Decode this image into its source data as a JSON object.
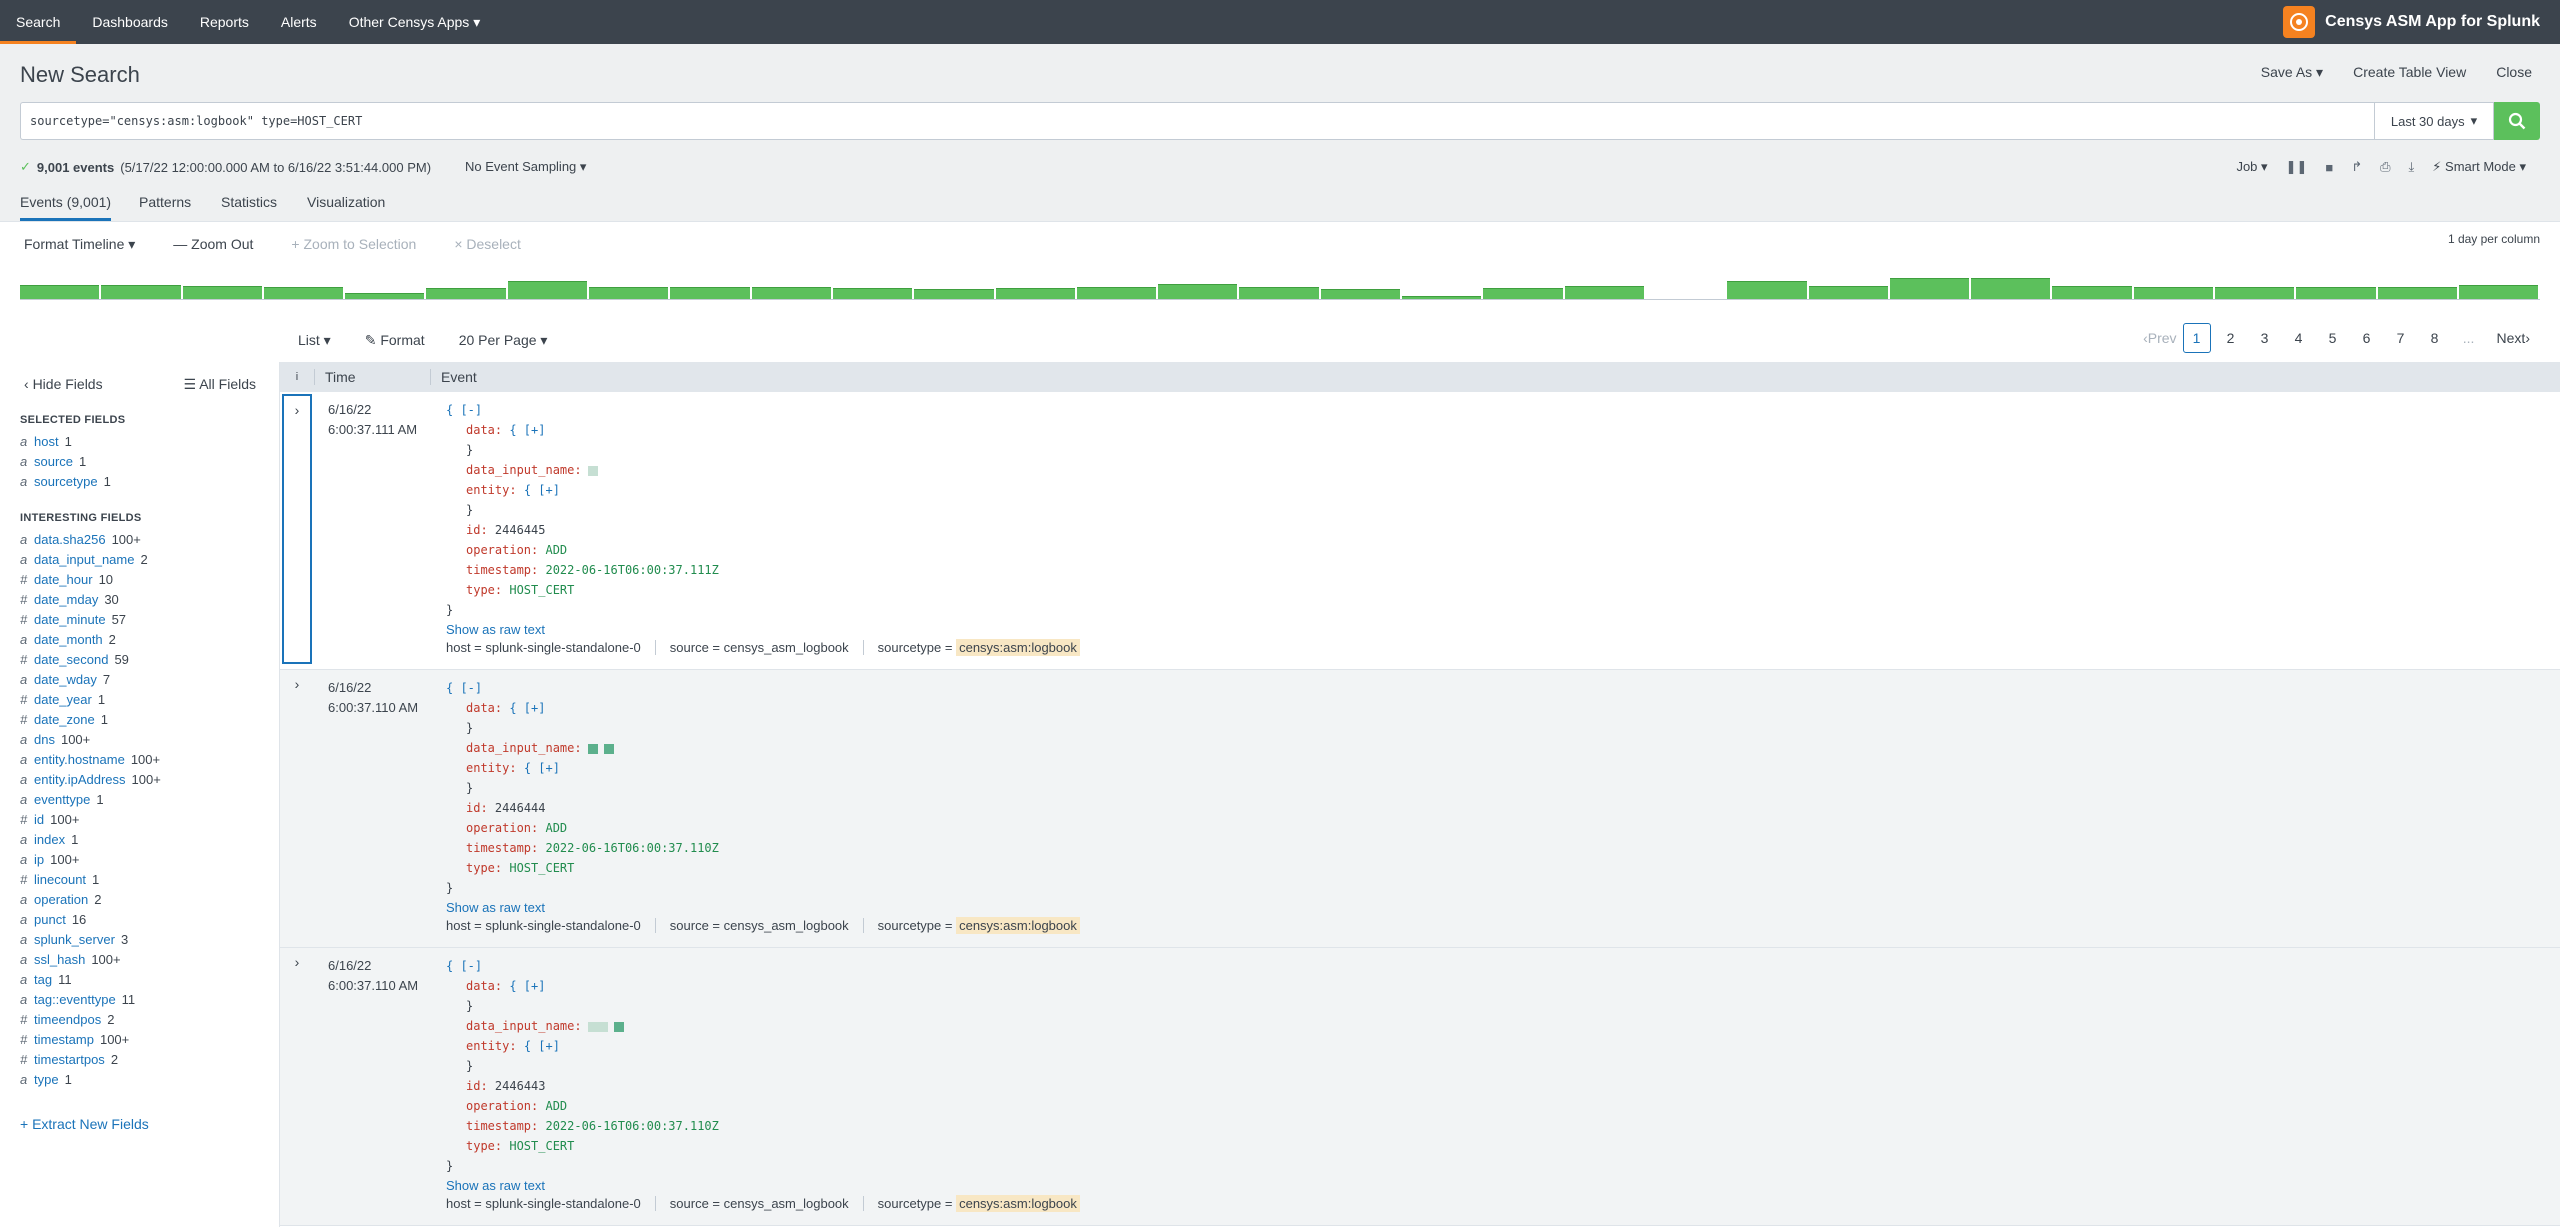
{
  "topbar": {
    "nav": [
      "Search",
      "Dashboards",
      "Reports",
      "Alerts",
      "Other Censys Apps"
    ],
    "active": "Search",
    "app_name": "Censys ASM App for Splunk"
  },
  "header": {
    "title": "New Search",
    "actions": [
      "Save As",
      "Create Table View",
      "Close"
    ]
  },
  "search": {
    "query": "sourcetype=\"censys:asm:logbook\" type=HOST_CERT",
    "time_range": "Last 30 days"
  },
  "status": {
    "count": "9,001 events",
    "range": "(5/17/22 12:00:00.000 AM to 6/16/22 3:51:44.000 PM)",
    "sampling": "No Event Sampling",
    "job": "Job",
    "mode": "Smart Mode"
  },
  "tabs": [
    "Events (9,001)",
    "Patterns",
    "Statistics",
    "Visualization"
  ],
  "timeline": {
    "controls": [
      "Format Timeline",
      "Zoom Out",
      "+ Zoom to Selection",
      "× Deselect"
    ],
    "scale": "1 day per column",
    "bars": [
      0.45,
      0.45,
      0.42,
      0.4,
      0.2,
      0.35,
      0.58,
      0.4,
      0.38,
      0.38,
      0.35,
      0.32,
      0.35,
      0.38,
      0.5,
      0.38,
      0.32,
      0.1,
      0.35,
      0.42,
      0,
      0.58,
      0.42,
      0.68,
      0.68,
      0.42,
      0.4,
      0.4,
      0.4,
      0.38,
      0.45
    ]
  },
  "results_toolbar": {
    "list": "List",
    "format": "Format",
    "per_page": "20 Per Page",
    "pager": {
      "prev": "Prev",
      "pages": [
        "1",
        "2",
        "3",
        "4",
        "5",
        "6",
        "7",
        "8"
      ],
      "ellipsis": "...",
      "next": "Next",
      "current": "1"
    }
  },
  "sidebar": {
    "hide": "Hide Fields",
    "all": "All Fields",
    "selected_title": "SELECTED FIELDS",
    "selected": [
      {
        "t": "a",
        "name": "host",
        "count": "1"
      },
      {
        "t": "a",
        "name": "source",
        "count": "1"
      },
      {
        "t": "a",
        "name": "sourcetype",
        "count": "1"
      }
    ],
    "interesting_title": "INTERESTING FIELDS",
    "interesting": [
      {
        "t": "a",
        "name": "data.sha256",
        "count": "100+"
      },
      {
        "t": "a",
        "name": "data_input_name",
        "count": "2"
      },
      {
        "t": "#",
        "name": "date_hour",
        "count": "10"
      },
      {
        "t": "#",
        "name": "date_mday",
        "count": "30"
      },
      {
        "t": "#",
        "name": "date_minute",
        "count": "57"
      },
      {
        "t": "a",
        "name": "date_month",
        "count": "2"
      },
      {
        "t": "#",
        "name": "date_second",
        "count": "59"
      },
      {
        "t": "a",
        "name": "date_wday",
        "count": "7"
      },
      {
        "t": "#",
        "name": "date_year",
        "count": "1"
      },
      {
        "t": "#",
        "name": "date_zone",
        "count": "1"
      },
      {
        "t": "a",
        "name": "dns",
        "count": "100+"
      },
      {
        "t": "a",
        "name": "entity.hostname",
        "count": "100+"
      },
      {
        "t": "a",
        "name": "entity.ipAddress",
        "count": "100+"
      },
      {
        "t": "a",
        "name": "eventtype",
        "count": "1"
      },
      {
        "t": "#",
        "name": "id",
        "count": "100+"
      },
      {
        "t": "a",
        "name": "index",
        "count": "1"
      },
      {
        "t": "a",
        "name": "ip",
        "count": "100+"
      },
      {
        "t": "#",
        "name": "linecount",
        "count": "1"
      },
      {
        "t": "a",
        "name": "operation",
        "count": "2"
      },
      {
        "t": "a",
        "name": "punct",
        "count": "16"
      },
      {
        "t": "a",
        "name": "splunk_server",
        "count": "3"
      },
      {
        "t": "a",
        "name": "ssl_hash",
        "count": "100+"
      },
      {
        "t": "a",
        "name": "tag",
        "count": "11"
      },
      {
        "t": "a",
        "name": "tag::eventtype",
        "count": "11"
      },
      {
        "t": "#",
        "name": "timeendpos",
        "count": "2"
      },
      {
        "t": "#",
        "name": "timestamp",
        "count": "100+"
      },
      {
        "t": "#",
        "name": "timestartpos",
        "count": "2"
      },
      {
        "t": "a",
        "name": "type",
        "count": "1"
      }
    ],
    "extract": "+ Extract New Fields"
  },
  "events_header": {
    "i": "i",
    "time": "Time",
    "event": "Event"
  },
  "events": [
    {
      "date": "6/16/22",
      "time": "6:00:37.111 AM",
      "id": "2446445",
      "operation": "ADD",
      "timestamp": "2022-06-16T06:00:37.111Z",
      "type": "HOST_CERT"
    },
    {
      "date": "6/16/22",
      "time": "6:00:37.110 AM",
      "id": "2446444",
      "operation": "ADD",
      "timestamp": "2022-06-16T06:00:37.110Z",
      "type": "HOST_CERT"
    },
    {
      "date": "6/16/22",
      "time": "6:00:37.110 AM",
      "id": "2446443",
      "operation": "ADD",
      "timestamp": "2022-06-16T06:00:37.110Z",
      "type": "HOST_CERT"
    }
  ],
  "event_labels": {
    "open": "{ [-]",
    "data": "data:",
    "data_val": "{ [+]",
    "close": "}",
    "dataname": "data_input_name:",
    "entity": "entity:",
    "id": "id:",
    "operation": "operation:",
    "timestamp": "timestamp:",
    "type": "type:",
    "raw": "Show as raw text",
    "host_k": "host =",
    "host_v": "splunk-single-standalone-0",
    "source_k": "source =",
    "source_v": "censys_asm_logbook",
    "st_k": "sourcetype =",
    "st_v": "censys:asm:logbook"
  }
}
